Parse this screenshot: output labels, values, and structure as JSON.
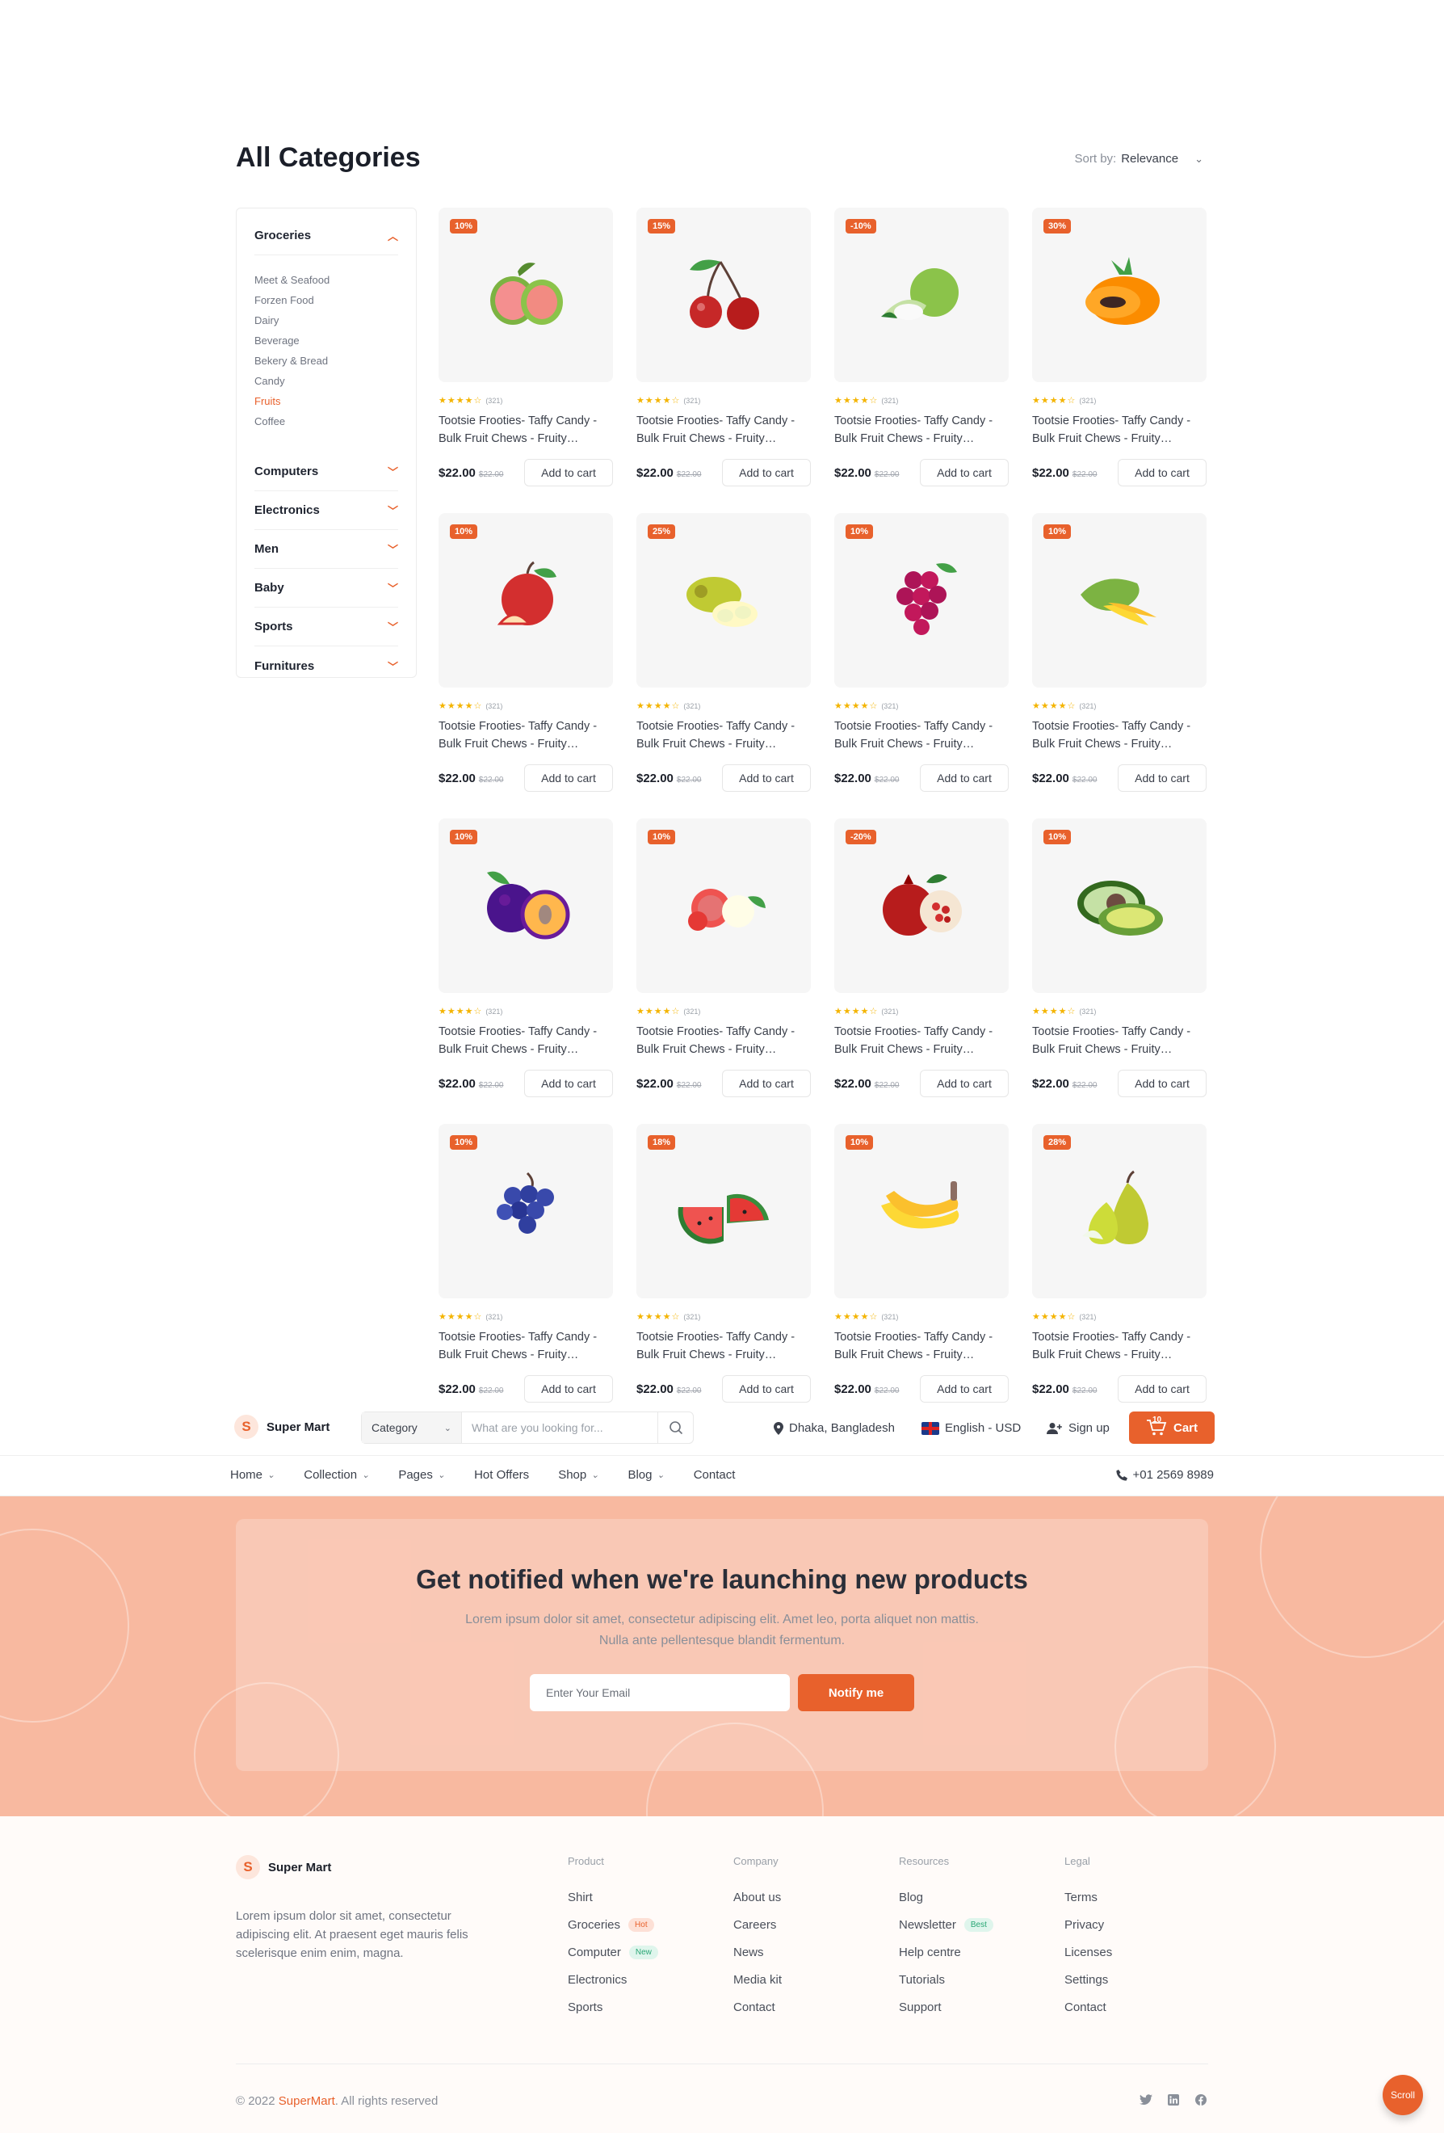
{
  "page": {
    "title": "All Categories"
  },
  "sort": {
    "label": "Sort by:",
    "value": "Relevance"
  },
  "sidebar": {
    "active_category": "Groceries",
    "subcategories": [
      "Meet & Seafood",
      "Forzen Food",
      "Dairy",
      "Beverage",
      "Bekery & Bread",
      "Candy",
      "Fruits",
      "Coffee"
    ],
    "active_subcategory": "Fruits",
    "categories": [
      "Computers",
      "Electronics",
      "Men",
      "Baby",
      "Sports",
      "Furnitures"
    ]
  },
  "product_common": {
    "name": "Tootsie Frooties- Taffy Candy - Bulk Fruit Chews - Fruity Rainbow",
    "rating_count": "(321)",
    "price": "$22.00",
    "old_price": "$22.00",
    "add_to_cart": "Add to cart"
  },
  "products": [
    {
      "badge": "10%",
      "fruit": "guava-icon"
    },
    {
      "badge": "15%",
      "fruit": "cherry-icon"
    },
    {
      "badge": "-10%",
      "fruit": "guava-green-icon"
    },
    {
      "badge": "30%",
      "fruit": "papaya-icon"
    },
    {
      "badge": "10%",
      "fruit": "apple-icon"
    },
    {
      "badge": "25%",
      "fruit": "jackfruit-icon"
    },
    {
      "badge": "10%",
      "fruit": "grapes-red-icon"
    },
    {
      "badge": "10%",
      "fruit": "mango-icon"
    },
    {
      "badge": "10%",
      "fruit": "plum-icon"
    },
    {
      "badge": "10%",
      "fruit": "lychee-icon"
    },
    {
      "badge": "-20%",
      "fruit": "pomegranate-icon"
    },
    {
      "badge": "10%",
      "fruit": "avocado-icon"
    },
    {
      "badge": "10%",
      "fruit": "grapes-blue-icon"
    },
    {
      "badge": "18%",
      "fruit": "watermelon-icon"
    },
    {
      "badge": "10%",
      "fruit": "banana-icon"
    },
    {
      "badge": "28%",
      "fruit": "pear-icon"
    }
  ],
  "header": {
    "logo": "Super Mart",
    "logo_mark": "S",
    "category_label": "Category",
    "search_placeholder": "What are you looking for...",
    "location": "Dhaka, Bangladesh",
    "language": "English - USD",
    "signup": "Sign up",
    "cart": "Cart",
    "cart_count": "10",
    "nav": [
      "Home",
      "Collection",
      "Pages",
      "Hot Offers",
      "Shop",
      "Blog",
      "Contact"
    ],
    "phone": "+01 2569 8989"
  },
  "newsletter": {
    "title": "Get notified when we're launching new products",
    "subtitle": "Lorem ipsum dolor sit amet, consectetur adipiscing elit. Amet leo, porta aliquet non mattis. Nulla ante pellentesque blandit fermentum.",
    "email_placeholder": "Enter Your Email",
    "button": "Notify me"
  },
  "footer": {
    "logo": "Super Mart",
    "description": "Lorem ipsum dolor sit amet, consectetur adipiscing elit. At praesent eget mauris felis scelerisque enim enim, magna.",
    "columns": [
      {
        "head": "Product",
        "items": [
          "Shirt",
          "Groceries",
          "Computer",
          "Electronics",
          "Sports"
        ]
      },
      {
        "head": "Company",
        "items": [
          "About us",
          "Careers",
          "News",
          "Media kit",
          "Contact"
        ]
      },
      {
        "head": "Resources",
        "items": [
          "Blog",
          "Newsletter",
          "Help centre",
          "Tutorials",
          "Support"
        ]
      },
      {
        "head": "Legal",
        "items": [
          "Terms",
          "Privacy",
          "Licenses",
          "Settings",
          "Contact"
        ]
      }
    ],
    "tags": {
      "groceries": "Hot",
      "computer": "New",
      "newsletter": "Best"
    },
    "copyright_prefix": "© 2022 ",
    "copyright_brand": "SuperMart",
    "copyright_suffix": ". All rights reserved",
    "scroll": "Scroll"
  },
  "colors": {
    "accent": "#e8612c",
    "newsletter_bg": "#f8b9a0",
    "star": "#f4b400"
  }
}
